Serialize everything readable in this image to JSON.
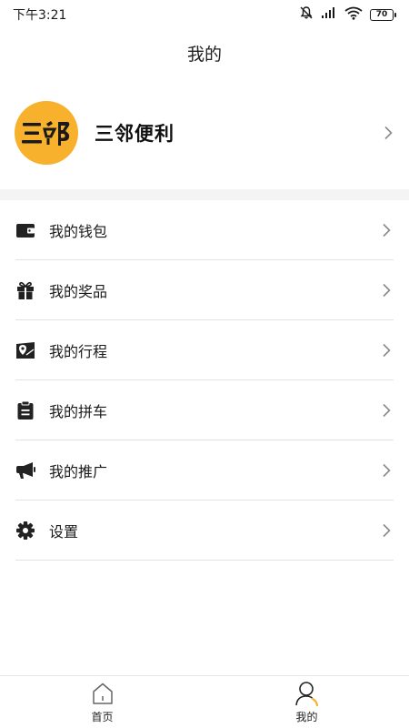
{
  "status_bar": {
    "time": "下午3:21",
    "battery": "70",
    "icons": [
      "mute-icon",
      "signal-icon",
      "wifi-icon",
      "battery-icon"
    ]
  },
  "header": {
    "title": "我的"
  },
  "profile": {
    "logo_text": "三邻",
    "name": "三邻便利",
    "accent_color": "#f7b12d"
  },
  "menu": {
    "items": [
      {
        "label": "我的钱包",
        "icon": "wallet-icon"
      },
      {
        "label": "我的奖品",
        "icon": "gift-icon"
      },
      {
        "label": "我的行程",
        "icon": "map-pin-icon"
      },
      {
        "label": "我的拼车",
        "icon": "clipboard-icon"
      },
      {
        "label": "我的推广",
        "icon": "megaphone-icon"
      },
      {
        "label": "设置",
        "icon": "gear-icon"
      }
    ]
  },
  "tab_bar": {
    "tabs": [
      {
        "label": "首页",
        "icon": "home-icon",
        "active": false
      },
      {
        "label": "我的",
        "icon": "user-icon",
        "active": true
      }
    ]
  }
}
